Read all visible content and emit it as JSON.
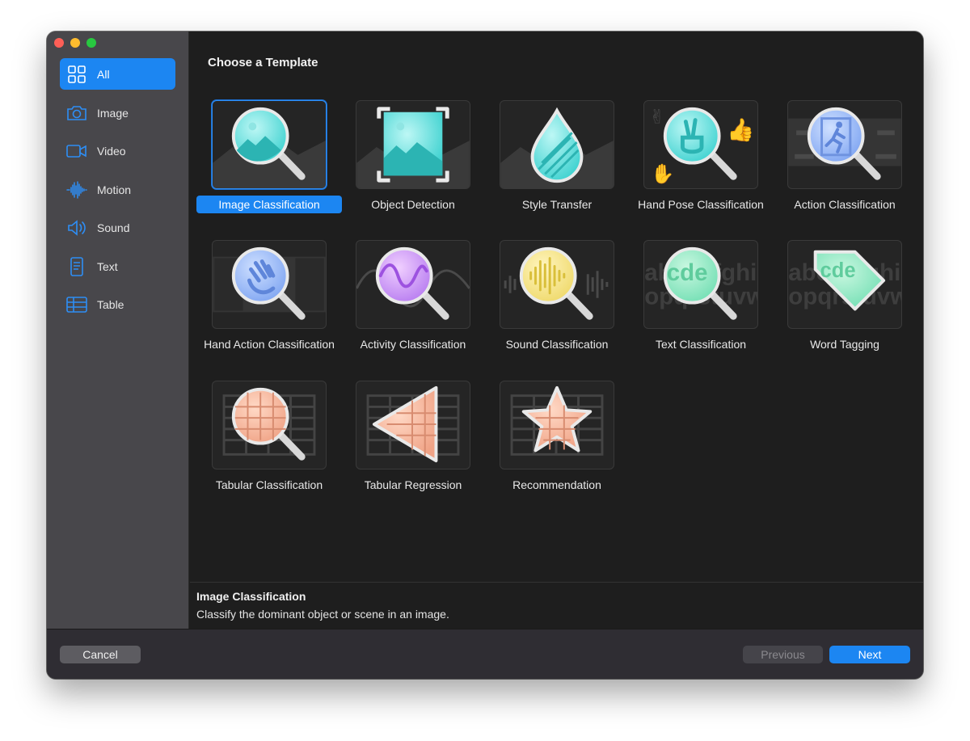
{
  "window": {
    "traffic_lights": [
      "close",
      "minimize",
      "zoom"
    ]
  },
  "sidebar": {
    "items": [
      {
        "label": "All",
        "icon": "grid-icon",
        "active": true
      },
      {
        "label": "Image",
        "icon": "camera-icon"
      },
      {
        "label": "Video",
        "icon": "video-camera-icon"
      },
      {
        "label": "Motion",
        "icon": "waveform-icon"
      },
      {
        "label": "Sound",
        "icon": "speaker-icon"
      },
      {
        "label": "Text",
        "icon": "document-icon"
      },
      {
        "label": "Table",
        "icon": "table-icon"
      }
    ],
    "accent_color": "#1c86f2"
  },
  "main": {
    "title": "Choose a Template",
    "templates": [
      {
        "label": "Image Classification",
        "icon": "magnifier-landscape-icon",
        "selected": true
      },
      {
        "label": "Object Detection",
        "icon": "framed-landscape-icon"
      },
      {
        "label": "Style Transfer",
        "icon": "striped-drop-icon"
      },
      {
        "label": "Hand Pose Classification",
        "icon": "magnifier-peace-hand-icon"
      },
      {
        "label": "Action Classification",
        "icon": "magnifier-running-person-icon"
      },
      {
        "label": "Hand Action Classification",
        "icon": "magnifier-waving-hand-icon"
      },
      {
        "label": "Activity Classification",
        "icon": "magnifier-sine-wave-icon"
      },
      {
        "label": "Sound Classification",
        "icon": "magnifier-audio-waveform-icon"
      },
      {
        "label": "Text Classification",
        "icon": "magnifier-letters-icon"
      },
      {
        "label": "Word Tagging",
        "icon": "tag-letters-icon"
      },
      {
        "label": "Tabular Classification",
        "icon": "magnifier-table-icon"
      },
      {
        "label": "Tabular Regression",
        "icon": "triangle-table-icon"
      },
      {
        "label": "Recommendation",
        "icon": "star-table-icon"
      }
    ]
  },
  "description": {
    "title": "Image Classification",
    "text": "Classify the dominant object or scene in an image."
  },
  "footer": {
    "cancel_label": "Cancel",
    "previous_label": "Previous",
    "next_label": "Next"
  }
}
